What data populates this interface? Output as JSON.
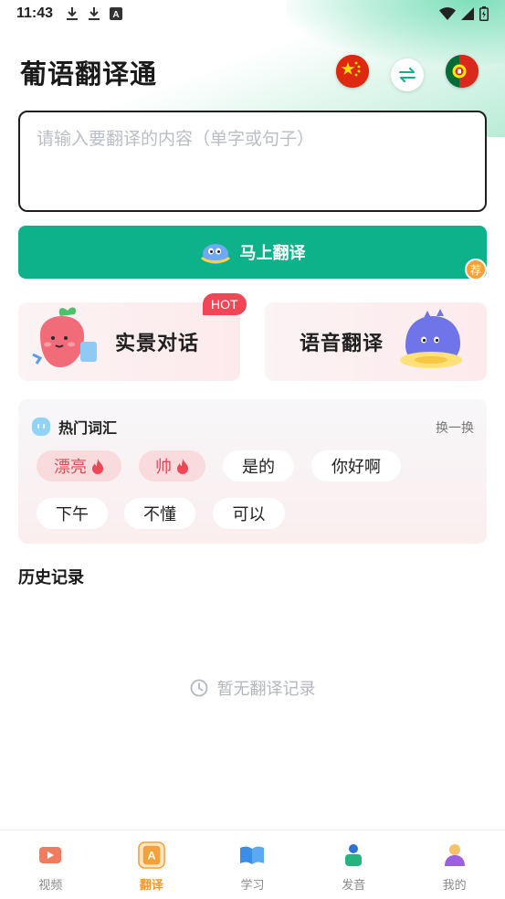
{
  "status_bar": {
    "time": "11:43",
    "left_icons": [
      "download-icon",
      "download-icon",
      "font-a-icon"
    ],
    "right_icons": [
      "wifi-icon",
      "signal-icon",
      "battery-icon"
    ]
  },
  "header": {
    "title": "葡语翻译通",
    "source_language_flag": "china-flag-icon",
    "target_language_flag": "portugal-flag-icon",
    "swap_icon": "swap-arrows-icon"
  },
  "input": {
    "placeholder": "请输入要翻译的内容（单字或句子）",
    "value": ""
  },
  "translate_button": {
    "label": "马上翻译",
    "badge": "荐"
  },
  "feature_cards": {
    "scene": {
      "label": "实景对话",
      "tag": "HOT"
    },
    "voice": {
      "label": "语音翻译"
    }
  },
  "hot_words": {
    "title": "热门词汇",
    "refresh_label": "换一换",
    "chips": [
      {
        "text": "漂亮",
        "hot": true
      },
      {
        "text": "帅",
        "hot": true
      },
      {
        "text": "是的",
        "hot": false
      },
      {
        "text": "你好啊",
        "hot": false
      },
      {
        "text": "下午",
        "hot": false
      },
      {
        "text": "不懂",
        "hot": false
      },
      {
        "text": "可以",
        "hot": false
      }
    ]
  },
  "history": {
    "title": "历史记录",
    "empty_text": "暂无翻译记录"
  },
  "bottom_nav": {
    "items": [
      {
        "label": "视频",
        "icon": "video-icon",
        "active": false
      },
      {
        "label": "翻译",
        "icon": "translate-icon",
        "active": true
      },
      {
        "label": "学习",
        "icon": "book-icon",
        "active": false
      },
      {
        "label": "发音",
        "icon": "pronunciation-icon",
        "active": false
      },
      {
        "label": "我的",
        "icon": "profile-icon",
        "active": false
      }
    ]
  },
  "colors": {
    "primary": "#0eb28a",
    "accent_active": "#f19a2d",
    "hot_red": "#f04655",
    "recommend_badge": "#f5a13a"
  }
}
